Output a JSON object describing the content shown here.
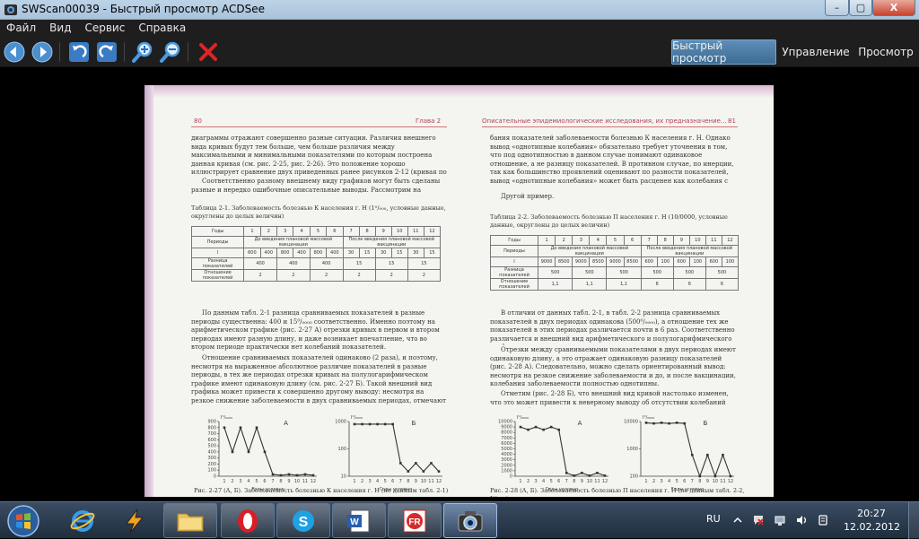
{
  "window": {
    "title": "SWScan00039 - Быстрый просмотр ACDSee",
    "min_label": "–",
    "max_label": "▢",
    "close_label": "X"
  },
  "menu": [
    "Файл",
    "Вид",
    "Сервис",
    "Справка"
  ],
  "mode_tabs": {
    "quick": "Быстрый просмотр",
    "manage": "Управление",
    "view": "Просмотр"
  },
  "page_left": {
    "number": "80",
    "chapter": "Глава 2",
    "p1": "диаграммы отражают совершенно разные ситуации. Различия внешнего вида кривых будут тем больше, чем больше различия между максимальными и минимальными показателями по которым построена данная кривая (см. рис. 2-25, рис. 2-26). Это положение хорошо иллюстрирует сравнение двух приведенных ранее рисунков 2-12 (кривая по основной шкале) и 2-13.",
    "p2": "Соответственно разному внешнему виду графиков могут быть сделаны разные и нередко ошибочные описательные выводы. Рассмотрим на примере.",
    "table_title": "Таблица 2-1. Заболеваемость болезнью К населения г. Н (1⁰/₀₀₀, условные данные, округлены до целых величин)",
    "table": {
      "years_label": "Годы",
      "years": [
        "1",
        "2",
        "3",
        "4",
        "5",
        "6",
        "7",
        "8",
        "9",
        "10",
        "11",
        "12"
      ],
      "periods_label": "Периоды",
      "period_before": "До введения плановой массовой вакцинации",
      "period_after": "После введения плановой массовой вакцинации",
      "row_i": "I",
      "values": [
        "600",
        "400",
        "800",
        "400",
        "800",
        "400",
        "30",
        "15",
        "30",
        "15",
        "30",
        "15"
      ],
      "diff_label": "Разница показателей",
      "diff": [
        "400",
        "400",
        "400",
        "15",
        "15",
        "15"
      ],
      "ratio_label": "Отношение показателей",
      "ratio": [
        "2",
        "2",
        "2",
        "2",
        "2",
        "2"
      ]
    },
    "p3": "По данным табл. 2-1 разница сравниваемых показателей в разные периоды существенна: 400 и 15⁰/₀₀₀₀ соответственно. Именно поэтому на арифметическом графике (рис. 2-27 А) отрезки кривых в первом и втором периодах имеют разную длину, и даже возникает впечатление, что во втором периоде практически нет колебаний показателей.",
    "p4": "Отношение сравниваемых показателей одинаково (2 раза), и поэтому, несмотря на выраженное абсолютное различие показателей в разные периоды, в тех же периодах отрезки кривых на полулогарифмическом графике имеют одинаковую длину (см. рис. 2-27 Б). Такой внешний вид графика может привести к совершенно другому выводу: несмотря на резкое снижение заболеваемости в двух сравниваемых периодах, отмечают однотипные коле-",
    "fig_caption": "Рис. 2-27 (А, Б). Заболеваемость болезнью К населения г. Н (по данным табл. 2-1)",
    "chart_a_label": "А",
    "chart_b_label": "Б",
    "y_unit": "I⁰/₀₀₀₀",
    "x_title": "Годы условно"
  },
  "page_right": {
    "number": "81",
    "header": "Описательные эпидемиологические исследования, их предназначение...",
    "p1": "бания показателей заболеваемости болезнью К населения г. Н. Однако вывод «однотипные колебания» обязательно требует уточнения в том, что под однотипностью в данном случае понимают одинаковое отношение, а не разницу показателей. В противном случае, по инерции, так как большинство проявлений оценивают по разности показателей, вывод «однотипные колебания» может быть расценен как колебания с одинаковой амплитудой.",
    "p2": "Другой пример.",
    "table_title": "Таблица 2-2. Заболеваемость болезнью П населения г. Н (10/0000, условные данные, округлены до целых величин)",
    "table": {
      "years_label": "Годы",
      "years": [
        "1",
        "2",
        "3",
        "4",
        "5",
        "6",
        "7",
        "8",
        "9",
        "10",
        "11",
        "12"
      ],
      "periods_label": "Периоды",
      "period_before": "До введения плановой массовой вакцинации",
      "period_after": "После введения плановой массовой вакцинации",
      "row_i": "I",
      "values": [
        "9000",
        "8500",
        "9000",
        "8500",
        "9000",
        "8500",
        "600",
        "100",
        "600",
        "100",
        "600",
        "100"
      ],
      "diff_label": "Разница показателей",
      "diff": [
        "500",
        "500",
        "500",
        "500",
        "500",
        "500"
      ],
      "ratio_label": "Отношение показателей",
      "ratio": [
        "1,1",
        "1,1",
        "1,1",
        "6",
        "6",
        "6"
      ]
    },
    "p3": "В отличии от данных табл. 2-1, в табл. 2-2 разница сравниваемых показателей в двух периодах одинакова (500⁰/₀₀₀₀), а отношение тех же показателей в этих периодах различается почти в 6 раз. Соответственно различается и внешний вид арифметического и полулогарифмического графиков.",
    "p4": "Отрезки между сравниваемыми показателями в двух периодах имеют одинаковую длину, а это отражает одинаковую разницу показателей (рис. 2-28 А). Следовательно, можно сделать ориентированный вывод: несмотря на резкое снижение заболеваемости и до, и после вакцинации, колебания заболеваемости полностью однотипны.",
    "p5": "Отметим (рис. 2-28 Б), что внешний вид кривой настолько изменен, что это может привести к неверному выводу об отсутствии колебаний показателей",
    "fig_caption": "Рис. 2-28 (А, Б). Заболеваемость болезнью П населения г. Н (по данным табл. 2-2, I⁰/₀₀₀₀)",
    "chart_a_label": "А",
    "chart_b_label": "Б",
    "y_unit": "I⁰/₀₀₀₀",
    "x_title": "Годы условно"
  },
  "taskbar": {
    "lang": "RU",
    "time": "20:27",
    "date": "12.02.2012"
  },
  "chart_data": [
    {
      "type": "line",
      "title": "А",
      "ylabel": "I⁰/₀₀₀₀",
      "xlabel": "Годы условно",
      "x": [
        1,
        2,
        3,
        4,
        5,
        6,
        7,
        8,
        9,
        10,
        11,
        12
      ],
      "y_ticks": [
        0,
        100,
        200,
        300,
        400,
        500,
        600,
        700,
        800,
        900
      ],
      "ylim": [
        0,
        900
      ],
      "values": [
        800,
        400,
        800,
        400,
        800,
        400,
        30,
        15,
        30,
        15,
        30,
        15
      ]
    },
    {
      "type": "line",
      "title": "Б",
      "ylabel": "I⁰/₀₀₀₀",
      "xlabel": "Годы условно",
      "y_scale": "log",
      "y_ticks": [
        10,
        100,
        1000
      ],
      "ylim": [
        10,
        1000
      ],
      "x": [
        1,
        2,
        3,
        4,
        5,
        6,
        7,
        8,
        9,
        10,
        11,
        12
      ],
      "values": [
        800,
        800,
        800,
        800,
        800,
        800,
        30,
        15,
        30,
        15,
        30,
        15
      ]
    },
    {
      "type": "line",
      "title": "А",
      "ylabel": "I⁰/₀₀₀₀",
      "xlabel": "Годы условно",
      "y_ticks": [
        0,
        1000,
        2000,
        3000,
        4000,
        5000,
        6000,
        7000,
        8000,
        9000,
        10000
      ],
      "ylim": [
        0,
        10000
      ],
      "x": [
        1,
        2,
        3,
        4,
        5,
        6,
        7,
        8,
        9,
        10,
        11,
        12
      ],
      "values": [
        9000,
        8500,
        9000,
        8500,
        9000,
        8500,
        600,
        100,
        600,
        100,
        600,
        100
      ]
    },
    {
      "type": "line",
      "title": "Б",
      "ylabel": "I⁰/₀₀₀₀",
      "xlabel": "Годы условно",
      "y_scale": "log",
      "y_ticks": [
        100,
        1000,
        10000
      ],
      "ylim": [
        100,
        10000
      ],
      "x": [
        1,
        2,
        3,
        4,
        5,
        6,
        7,
        8,
        9,
        10,
        11,
        12
      ],
      "values": [
        9000,
        8500,
        9000,
        8500,
        9000,
        8500,
        600,
        100,
        600,
        100,
        600,
        100
      ]
    }
  ]
}
